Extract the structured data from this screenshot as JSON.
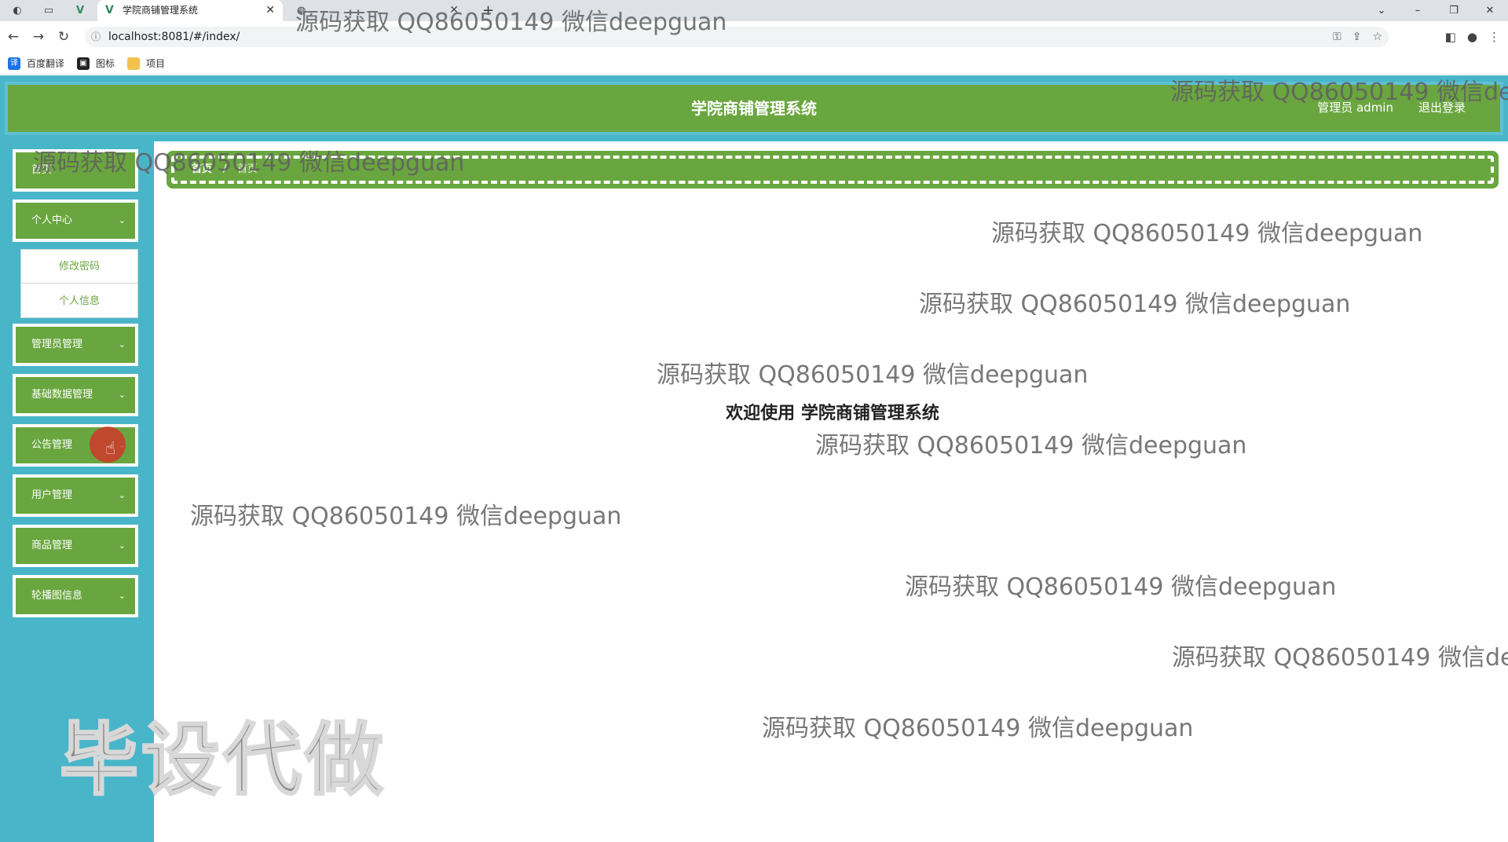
{
  "browser": {
    "active_tab": {
      "title": "学院商铺管理系统"
    },
    "address_url": "localhost:8081/#/index/",
    "bookmarks": [
      {
        "label": "百度翻译",
        "icon": "translate-icon",
        "color": "#1a73e8"
      },
      {
        "label": "图标",
        "icon": "icon-library-icon",
        "color": "#222222"
      },
      {
        "label": "项目",
        "icon": "folder-icon",
        "color": "#f2c14e"
      }
    ]
  },
  "header": {
    "title": "学院商铺管理系统",
    "user": "管理员 admin",
    "logout": "退出登录"
  },
  "sidebar": {
    "items": [
      {
        "label": "首页",
        "expandable": false
      },
      {
        "label": "个人中心",
        "expandable": true,
        "expanded": true
      },
      {
        "label": "管理员管理",
        "expandable": true
      },
      {
        "label": "基础数据管理",
        "expandable": true
      },
      {
        "label": "公告管理",
        "expandable": true
      },
      {
        "label": "用户管理",
        "expandable": true
      },
      {
        "label": "商品管理",
        "expandable": true
      },
      {
        "label": "轮播图信息",
        "expandable": true
      }
    ],
    "submenu": [
      "修改密码",
      "个人信息"
    ]
  },
  "breadcrumb": {
    "home": "首页",
    "separator": "/",
    "current": "首页"
  },
  "main": {
    "welcome": "欢迎使用 学院商铺管理系统"
  },
  "watermark": {
    "text": "源码获取 QQ86050149 微信deepguan",
    "truncated": "源码获取 QQ86050149 微信de",
    "truncated_short": "源码获取 QQ86050149 微信dee",
    "stamp": "毕设代做"
  },
  "colors": {
    "header_green": "#6aa63f",
    "sidebar_teal": "#49b5c9",
    "frame_teal": "#5fc0d4",
    "text_white": "#ffffff"
  }
}
